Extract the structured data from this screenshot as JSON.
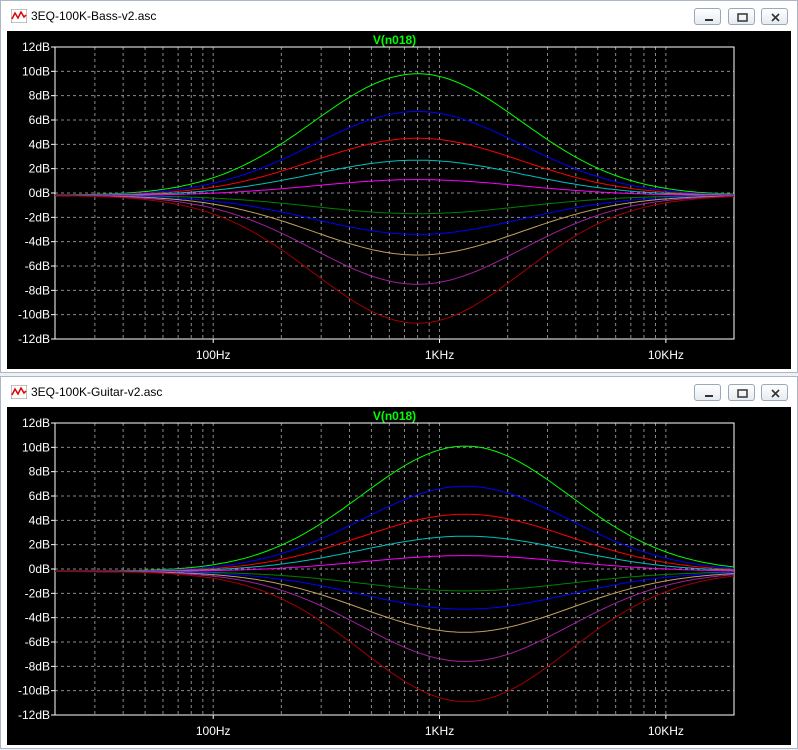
{
  "windows": [
    {
      "title": "3EQ-100K-Bass-v2.asc",
      "chart_data": {
        "type": "line",
        "title": "V(n018)",
        "xscale": "log",
        "xlim": [
          20,
          20000
        ],
        "ylim": [
          -12,
          12
        ],
        "y_ticks": [
          "12dB",
          "10dB",
          "8dB",
          "6dB",
          "4dB",
          "2dB",
          "0dB",
          "-2dB",
          "-4dB",
          "-6dB",
          "-8dB",
          "-10dB",
          "-12dB"
        ],
        "x_ticks": [
          "100Hz",
          "1KHz",
          "10KHz"
        ],
        "grid": true,
        "center_freq": 800,
        "series": [
          {
            "color": "#00ff00",
            "peak_db": 10.0
          },
          {
            "color": "#0000ff",
            "peak_db": 6.9
          },
          {
            "color": "#ff0000",
            "peak_db": 4.7
          },
          {
            "color": "#00c0c0",
            "peak_db": 2.9
          },
          {
            "color": "#ff00ff",
            "peak_db": 1.3
          },
          {
            "color": "#008000",
            "peak_db": -1.5
          },
          {
            "color": "#0000ff",
            "peak_db": -3.2
          },
          {
            "color": "#c0a060",
            "peak_db": -4.9
          },
          {
            "color": "#a020a0",
            "peak_db": -7.3
          },
          {
            "color": "#a00000",
            "peak_db": -10.5
          }
        ]
      }
    },
    {
      "title": "3EQ-100K-Guitar-v2.asc",
      "chart_data": {
        "type": "line",
        "title": "V(n018)",
        "xscale": "log",
        "xlim": [
          20,
          20000
        ],
        "ylim": [
          -12,
          12
        ],
        "y_ticks": [
          "12dB",
          "10dB",
          "8dB",
          "6dB",
          "4dB",
          "2dB",
          "0dB",
          "-2dB",
          "-4dB",
          "-6dB",
          "-8dB",
          "-10dB",
          "-12dB"
        ],
        "x_ticks": [
          "100Hz",
          "1KHz",
          "10KHz"
        ],
        "grid": true,
        "center_freq": 1300,
        "series": [
          {
            "color": "#00ff00",
            "peak_db": 10.3
          },
          {
            "color": "#0000ff",
            "peak_db": 7.0
          },
          {
            "color": "#ff0000",
            "peak_db": 4.7
          },
          {
            "color": "#00c0c0",
            "peak_db": 2.9
          },
          {
            "color": "#ff00ff",
            "peak_db": 1.3
          },
          {
            "color": "#008000",
            "peak_db": -1.6
          },
          {
            "color": "#0000ff",
            "peak_db": -3.1
          },
          {
            "color": "#c0a060",
            "peak_db": -5.0
          },
          {
            "color": "#a020a0",
            "peak_db": -7.4
          },
          {
            "color": "#a00000",
            "peak_db": -10.7
          }
        ]
      }
    }
  ],
  "icons": {
    "app": "waveform-icon",
    "minimize": "minimize-icon",
    "restore": "restore-icon",
    "close": "close-icon"
  }
}
